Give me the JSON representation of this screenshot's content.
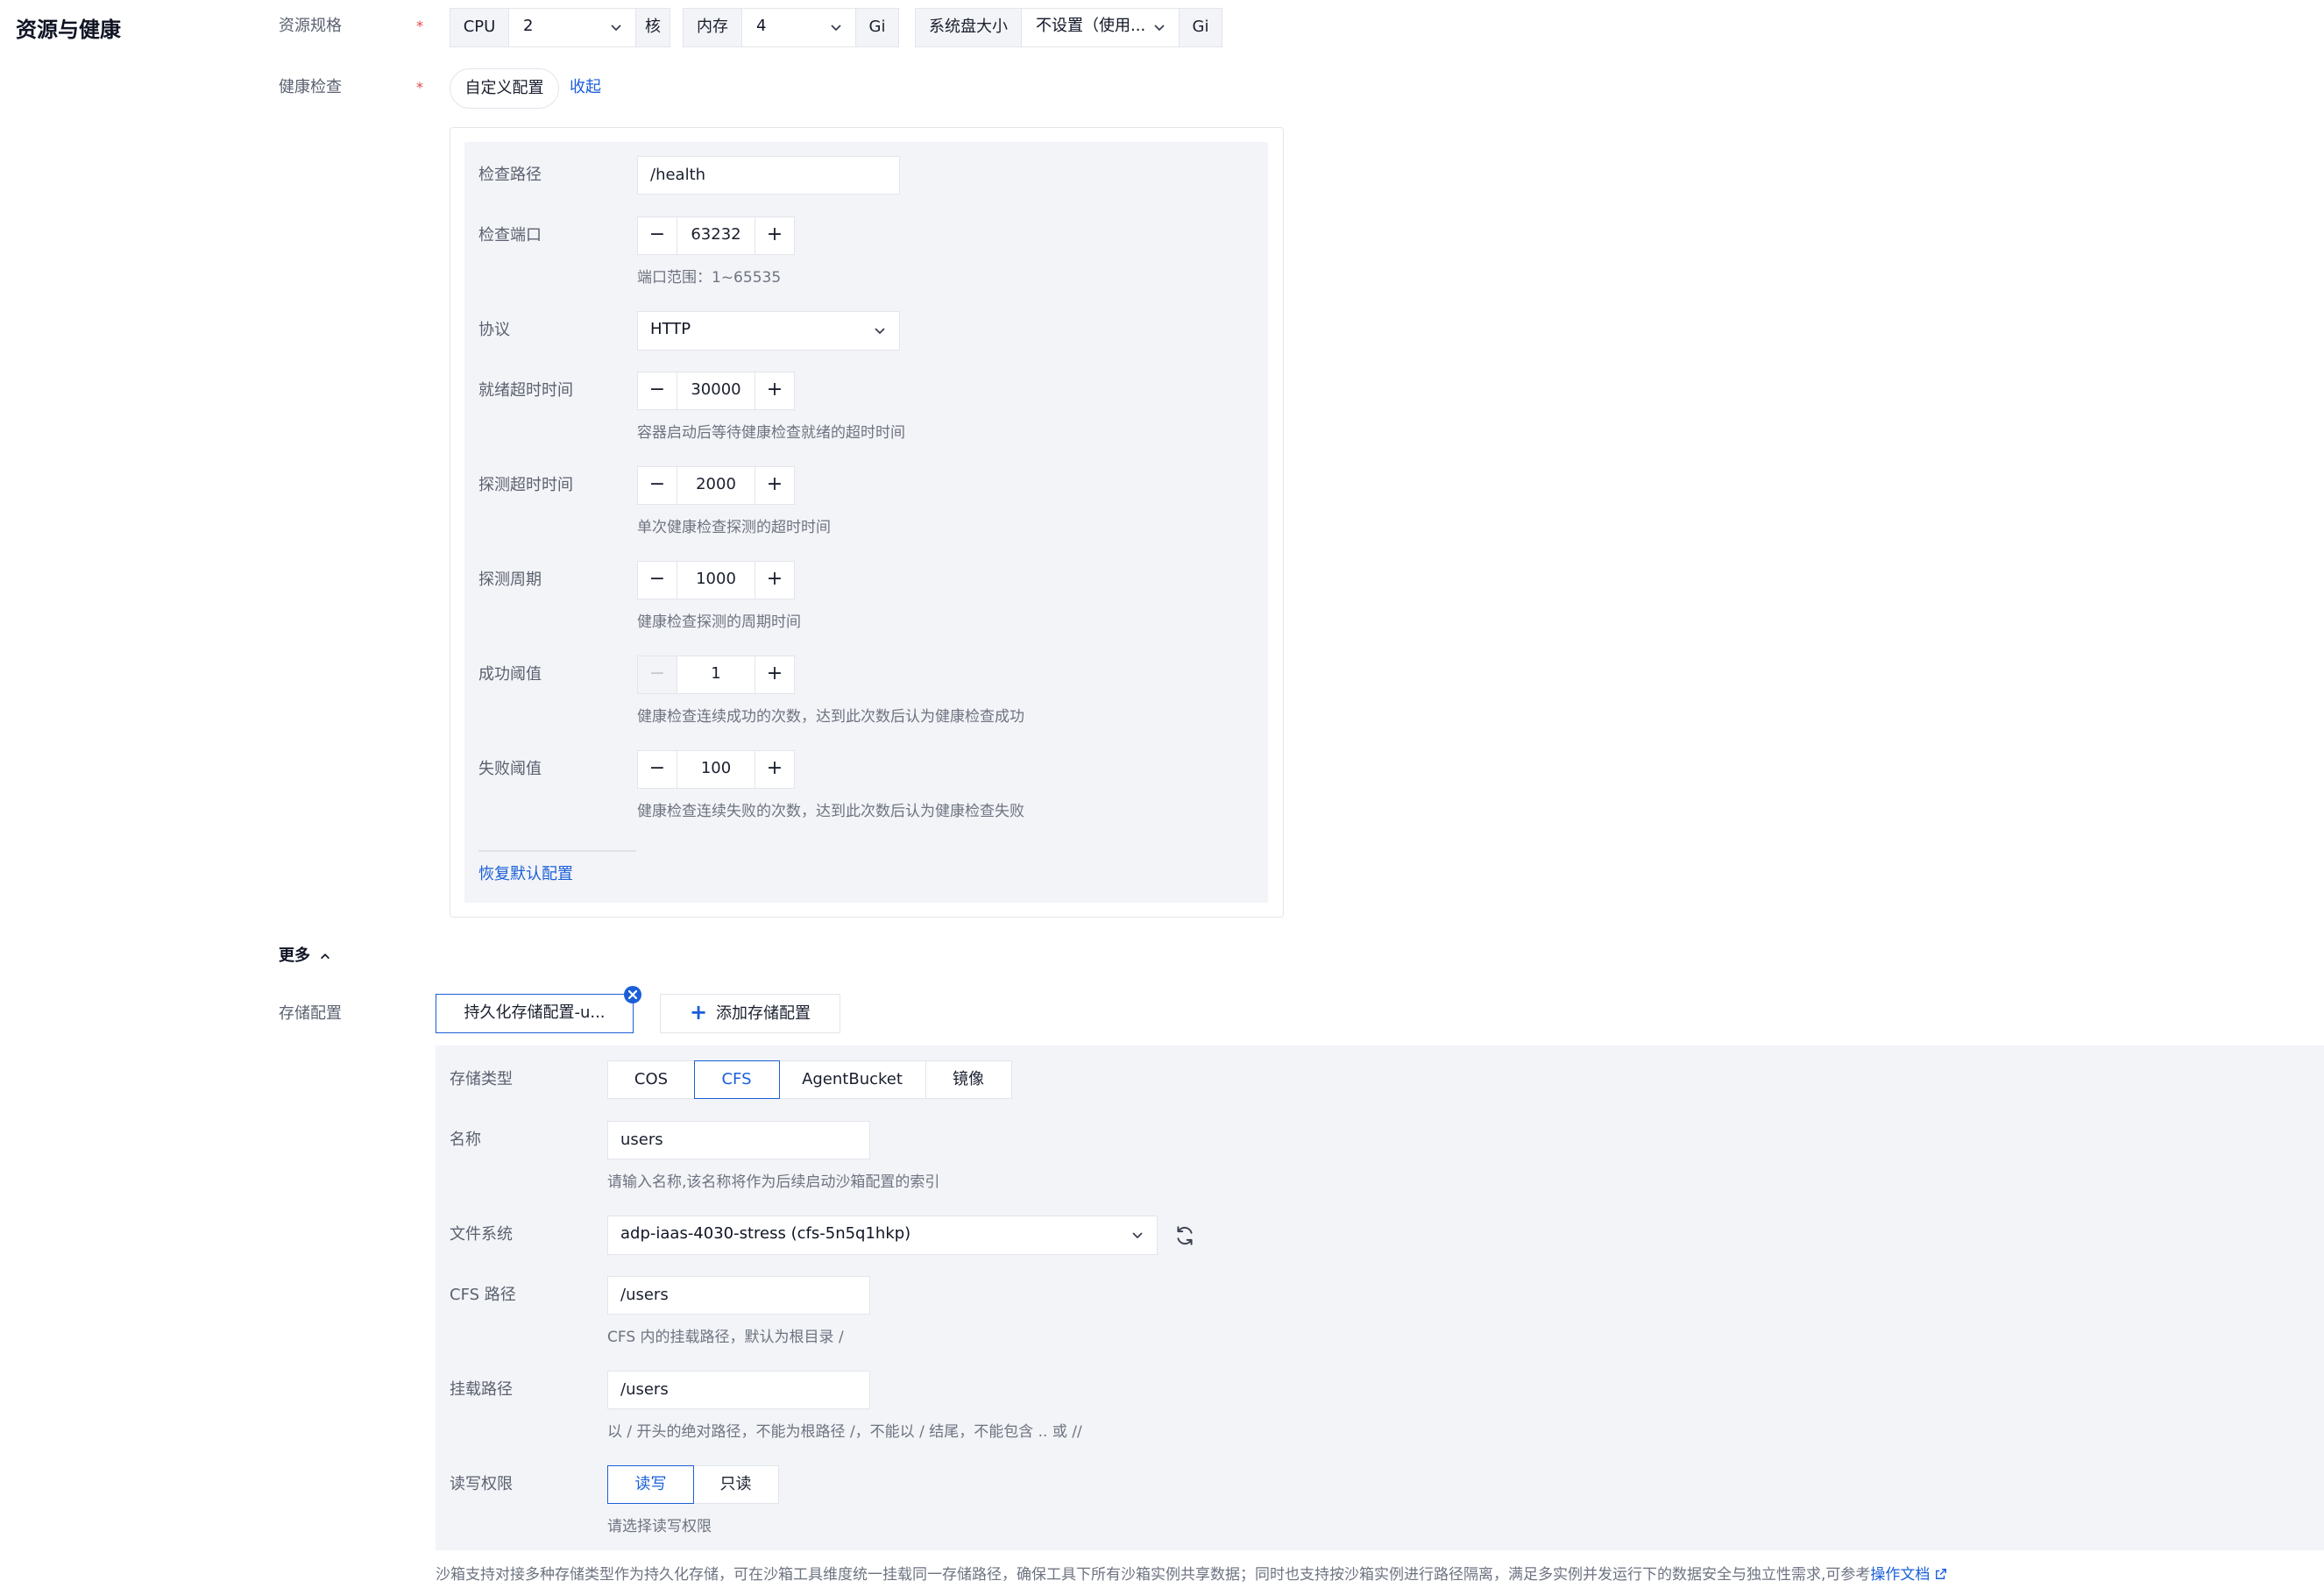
{
  "section": {
    "title": "资源与健康"
  },
  "resource": {
    "label": "资源规格",
    "required_mark": "*",
    "cpu": {
      "label": "CPU",
      "value": "2",
      "unit": "核"
    },
    "memory": {
      "label": "内存",
      "value": "4",
      "unit": "Gi"
    },
    "disk": {
      "label": "系统盘大小",
      "value": "不设置（使用...",
      "unit": "Gi"
    }
  },
  "health": {
    "label": "健康检查",
    "required_mark": "*",
    "mode_button": "自定义配置",
    "collapse_link": "收起",
    "path": {
      "label": "检查路径",
      "value": "/health"
    },
    "port": {
      "label": "检查端口",
      "value": "63232",
      "hint": "端口范围：1~65535"
    },
    "protocol": {
      "label": "协议",
      "value": "HTTP"
    },
    "ready_timeout": {
      "label": "就绪超时时间",
      "value": "30000",
      "hint": "容器启动后等待健康检查就绪的超时时间"
    },
    "probe_timeout": {
      "label": "探测超时时间",
      "value": "2000",
      "hint": "单次健康检查探测的超时时间"
    },
    "probe_period": {
      "label": "探测周期",
      "value": "1000",
      "hint": "健康检查探测的周期时间"
    },
    "success_threshold": {
      "label": "成功阈值",
      "value": "1",
      "hint": "健康检查连续成功的次数，达到此次数后认为健康检查成功"
    },
    "failure_threshold": {
      "label": "失败阈值",
      "value": "100",
      "hint": "健康检查连续失败的次数，达到此次数后认为健康检查失败"
    },
    "reset_link": "恢复默认配置",
    "minus": "−",
    "plus": "+"
  },
  "more": {
    "label": "更多"
  },
  "storage": {
    "label": "存储配置",
    "tab_label": "持久化存储配置-u...",
    "add_button": "添加存储配置",
    "type": {
      "label": "存储类型",
      "options": [
        "COS",
        "CFS",
        "AgentBucket",
        "镜像"
      ],
      "selected": "CFS"
    },
    "name": {
      "label": "名称",
      "value": "users",
      "hint": "请输入名称,该名称将作为后续启动沙箱配置的索引"
    },
    "filesystem": {
      "label": "文件系统",
      "value": "adp-iaas-4030-stress (cfs-5n5q1hkp)"
    },
    "cfs_path": {
      "label": "CFS 路径",
      "value": "/users",
      "hint": "CFS 内的挂载路径，默认为根目录 /"
    },
    "mount_path": {
      "label": "挂载路径",
      "value": "/users",
      "hint": "以 / 开头的绝对路径，不能为根路径 /，不能以 / 结尾，不能包含 .. 或 //"
    },
    "permission": {
      "label": "读写权限",
      "options": [
        "读写",
        "只读"
      ],
      "selected": "读写",
      "hint": "请选择读写权限"
    },
    "footer_note": "沙箱支持对接多种存储类型作为持久化存储，可在沙箱工具维度统一挂载同一存储路径，确保工具下所有沙箱实例共享数据；同时也支持按沙箱实例进行路径隔离，满足多实例并发运行下的数据安全与独立性需求,可参考",
    "doc_link": "操作文档"
  },
  "colors": {
    "accent": "#1a5fd8",
    "required": "#e54545",
    "panel_bg": "#f3f4f7"
  }
}
